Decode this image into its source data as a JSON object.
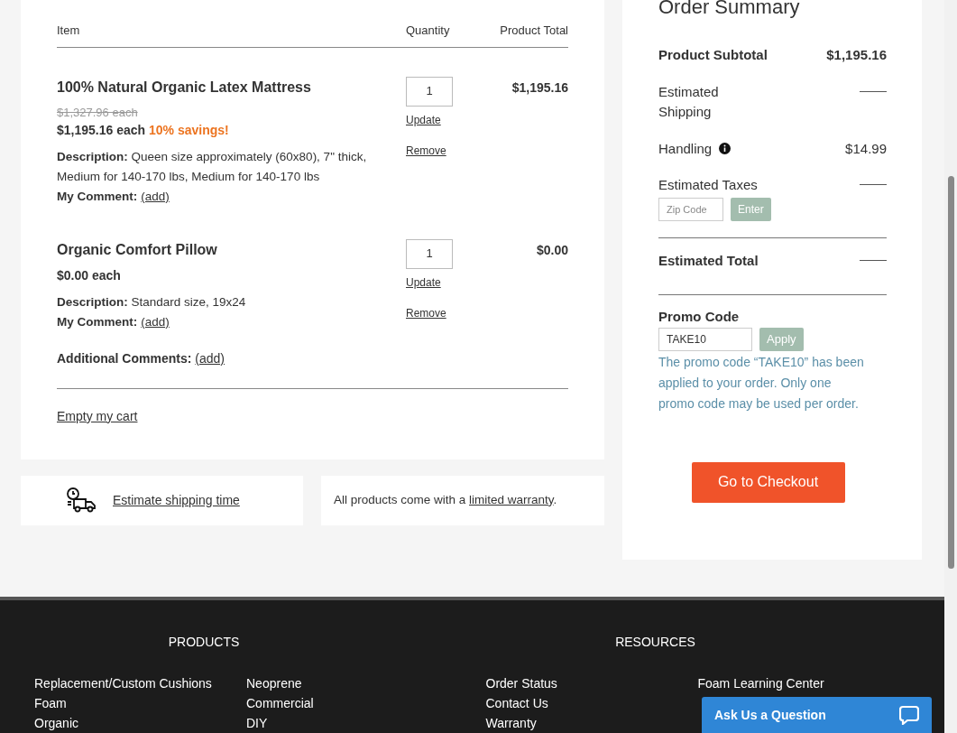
{
  "cart": {
    "columns": [
      "Item",
      "Quantity",
      "Product Total"
    ],
    "items": [
      {
        "name": "100% Natural Organic Latex Mattress",
        "original_price": "$1,327.96 each",
        "price_each": "$1,195.16 each",
        "savings": "10% savings!",
        "description_label": "Description:",
        "description": "Queen size approximately (60x80), 7\" thick, Medium for 140-170 lbs, Medium for 140-170 lbs",
        "comment_label": "My Comment:",
        "comment_link": "(add)",
        "quantity": "1",
        "update": "Update",
        "remove": "Remove",
        "total": "$1,195.16"
      },
      {
        "name": "Organic Comfort Pillow",
        "price_each": "$0.00 each",
        "description_label": "Description:",
        "description": "Standard size, 19x24",
        "comment_label": "My Comment:",
        "comment_link": "(add)",
        "quantity": "1",
        "update": "Update",
        "remove": "Remove",
        "total": "$0.00"
      }
    ],
    "additional_comments_label": "Additional Comments:",
    "additional_comments_link": "(add)",
    "empty_cart": "Empty my cart"
  },
  "shipping_card": {
    "link": "Estimate shipping time"
  },
  "warranty_card": {
    "text": "All products come with a ",
    "link": "limited warranty",
    "suffix": "."
  },
  "order_summary": {
    "title": "Order Summary",
    "rows": [
      {
        "label": "Product Subtotal",
        "value": "$1,195.16",
        "bold": true,
        "info": false
      },
      {
        "label": "Estimated Shipping",
        "bold": false,
        "info": false
      },
      {
        "label": "Handling",
        "value": "$14.99",
        "bold": false,
        "info": true
      },
      {
        "label": "Estimated Taxes",
        "bold": false,
        "info": false,
        "zip_placeholder": "Zip Code",
        "zip_button": "Enter"
      }
    ],
    "total_label": "Estimated Total",
    "promo_label": "Promo Code",
    "promo_value": "TAKE10",
    "promo_button": "Apply",
    "promo_message": "The promo code “TAKE10” has been applied to your order. Only one promo code may be used per order.",
    "checkout": "Go to Checkout"
  },
  "footer": {
    "sections": [
      {
        "title": "PRODUCTS",
        "columns": [
          [
            "Replacement/Custom Cushions",
            "Foam",
            "Organic"
          ],
          [
            "Neoprene",
            "Commercial",
            "DIY"
          ]
        ]
      },
      {
        "title": "RESOURCES",
        "columns": [
          [
            "Order Status",
            "Contact Us",
            "Warranty"
          ],
          [
            "Foam Learning Center"
          ]
        ]
      }
    ]
  },
  "chat_widget": {
    "label": "Ask Us a Question"
  }
}
